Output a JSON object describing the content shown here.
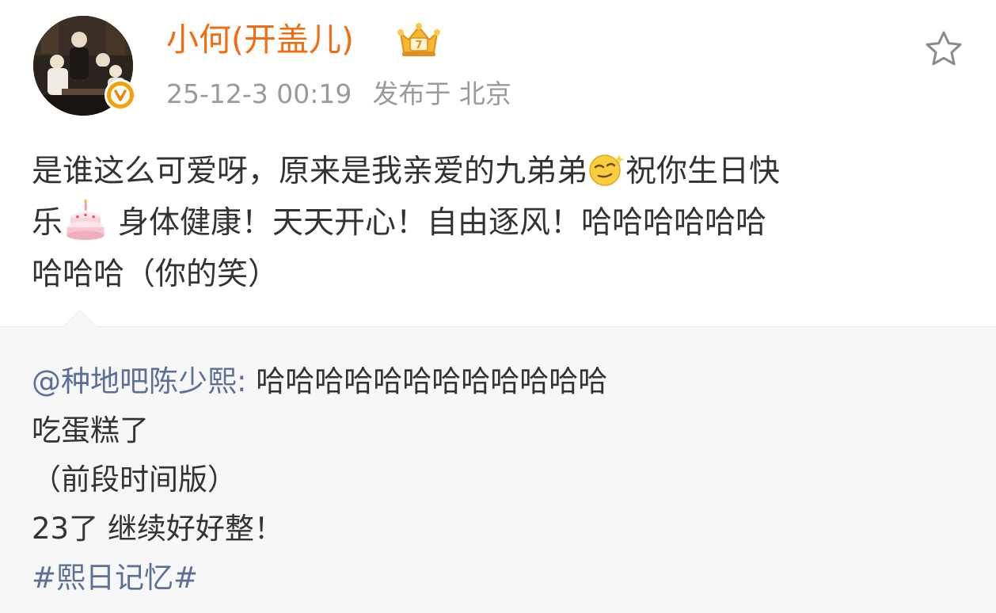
{
  "author": {
    "name": "小何(开盖儿)",
    "name_color": "#f26d0f",
    "verified_badge": "V",
    "verified_color": "#f3a10a",
    "member_icon": "crown-member-icon"
  },
  "meta": {
    "time": "25-12-3 00:19",
    "location": "发布于 北京"
  },
  "favorite_icon": "star-outline-icon",
  "post": {
    "line1_a": "是谁这么可爱呀，原来是我亲爱的九弟弟",
    "line1_emoji": "smirk-emoji",
    "line1_b": "祝你生日快",
    "line2_a": "乐",
    "line2_emoji": "cake-emoji",
    "line2_b": "身体健康！天天开心！自由逐风！哈哈哈哈哈哈",
    "line3": "哈哈哈（你的笑）"
  },
  "repost": {
    "mention": "@种地吧陈少熙",
    "colon": ": ",
    "line1_text": "哈哈哈哈哈哈哈哈哈哈哈哈",
    "line2": "吃蛋糕了",
    "line3": "（前段时间版）",
    "line4": "23了 继续好好整！",
    "hashtag": "#熙日记忆#",
    "link_color": "#5b6f97"
  }
}
